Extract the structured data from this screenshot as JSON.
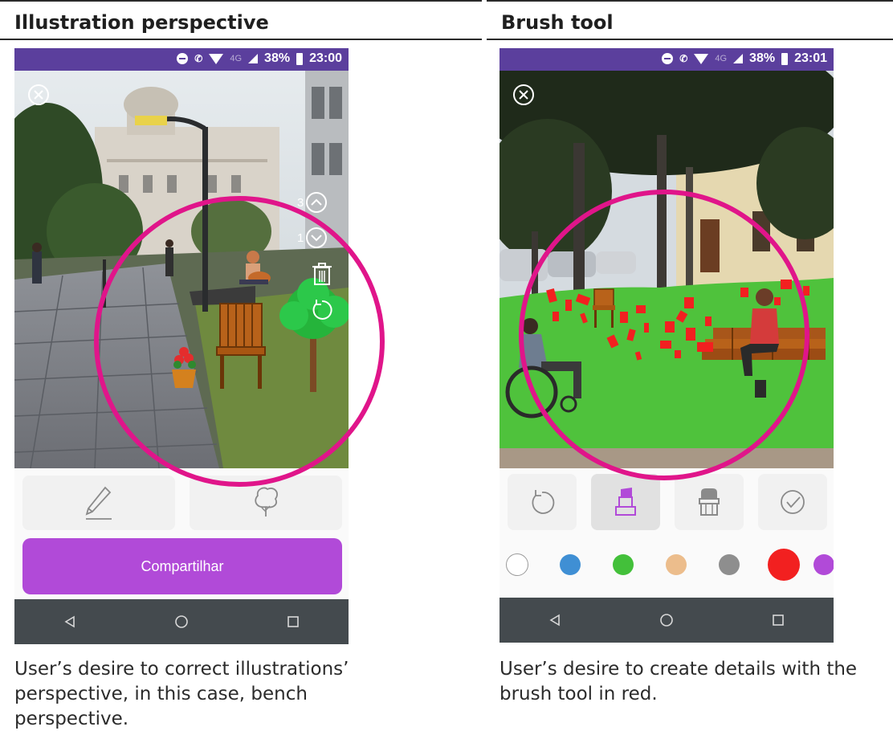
{
  "left_panel": {
    "title": "Illustration perspective",
    "status": {
      "battery": "38%",
      "time": "23:00",
      "network": "4G"
    },
    "side_counts": {
      "up": "3",
      "down": "1"
    },
    "share_label": "Compartilhar",
    "caption": "User’s desire to correct illustrations’ perspective, in this case, bench perspective."
  },
  "right_panel": {
    "title": "Brush tool",
    "status": {
      "battery": "38%",
      "time": "23:01",
      "network": "4G"
    },
    "caption": "User’s desire to create details with the brush tool in red."
  },
  "colors": {
    "status_bar": "#5b3f9d",
    "accent": "#b14ad8",
    "highlight_ring": "#e0158a",
    "nav_bar": "#444a4e",
    "grass": "#4fc23c",
    "brush_red": "#f22020"
  },
  "brush_palette": [
    {
      "name": "white",
      "hex": "#ffffff"
    },
    {
      "name": "blue",
      "hex": "#3f8fd4"
    },
    {
      "name": "green",
      "hex": "#43c03a"
    },
    {
      "name": "peach",
      "hex": "#ecbd8c"
    },
    {
      "name": "gray",
      "hex": "#8e8e8e"
    },
    {
      "name": "red",
      "hex": "#f22020",
      "selected": true
    },
    {
      "name": "purple",
      "hex": "#b14ad8"
    }
  ]
}
